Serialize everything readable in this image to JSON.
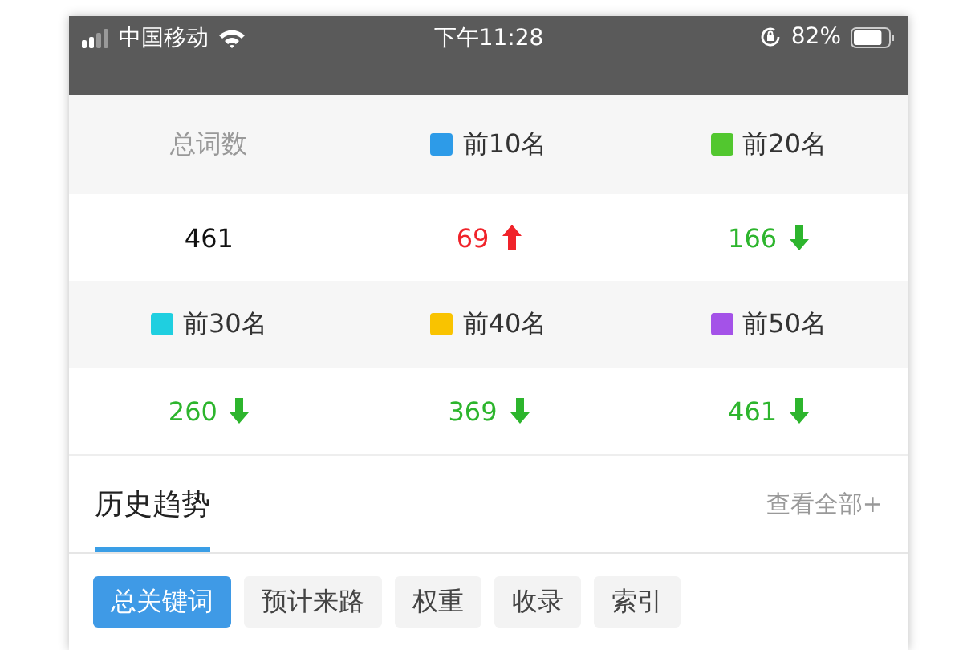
{
  "status_bar": {
    "carrier": "中国移动",
    "time": "下午11:28",
    "battery": "82%"
  },
  "stats": [
    {
      "label": "总词数",
      "value": "461",
      "kind": "plain"
    },
    {
      "label": "前10名",
      "color": "#2d9be8",
      "value": "69",
      "kind": "up"
    },
    {
      "label": "前20名",
      "color": "#52c72f",
      "value": "166",
      "kind": "down"
    },
    {
      "label": "前30名",
      "color": "#1fcfe0",
      "value": "260",
      "kind": "down"
    },
    {
      "label": "前40名",
      "color": "#f9c300",
      "value": "369",
      "kind": "down"
    },
    {
      "label": "前50名",
      "color": "#a452e8",
      "value": "461",
      "kind": "down"
    }
  ],
  "section": {
    "title": "历史趋势",
    "link": "查看全部+"
  },
  "tabs": [
    {
      "label": "总关键词",
      "selected": true
    },
    {
      "label": "预计来路",
      "selected": false
    },
    {
      "label": "权重",
      "selected": false
    },
    {
      "label": "收录",
      "selected": false
    },
    {
      "label": "索引",
      "selected": false
    }
  ]
}
